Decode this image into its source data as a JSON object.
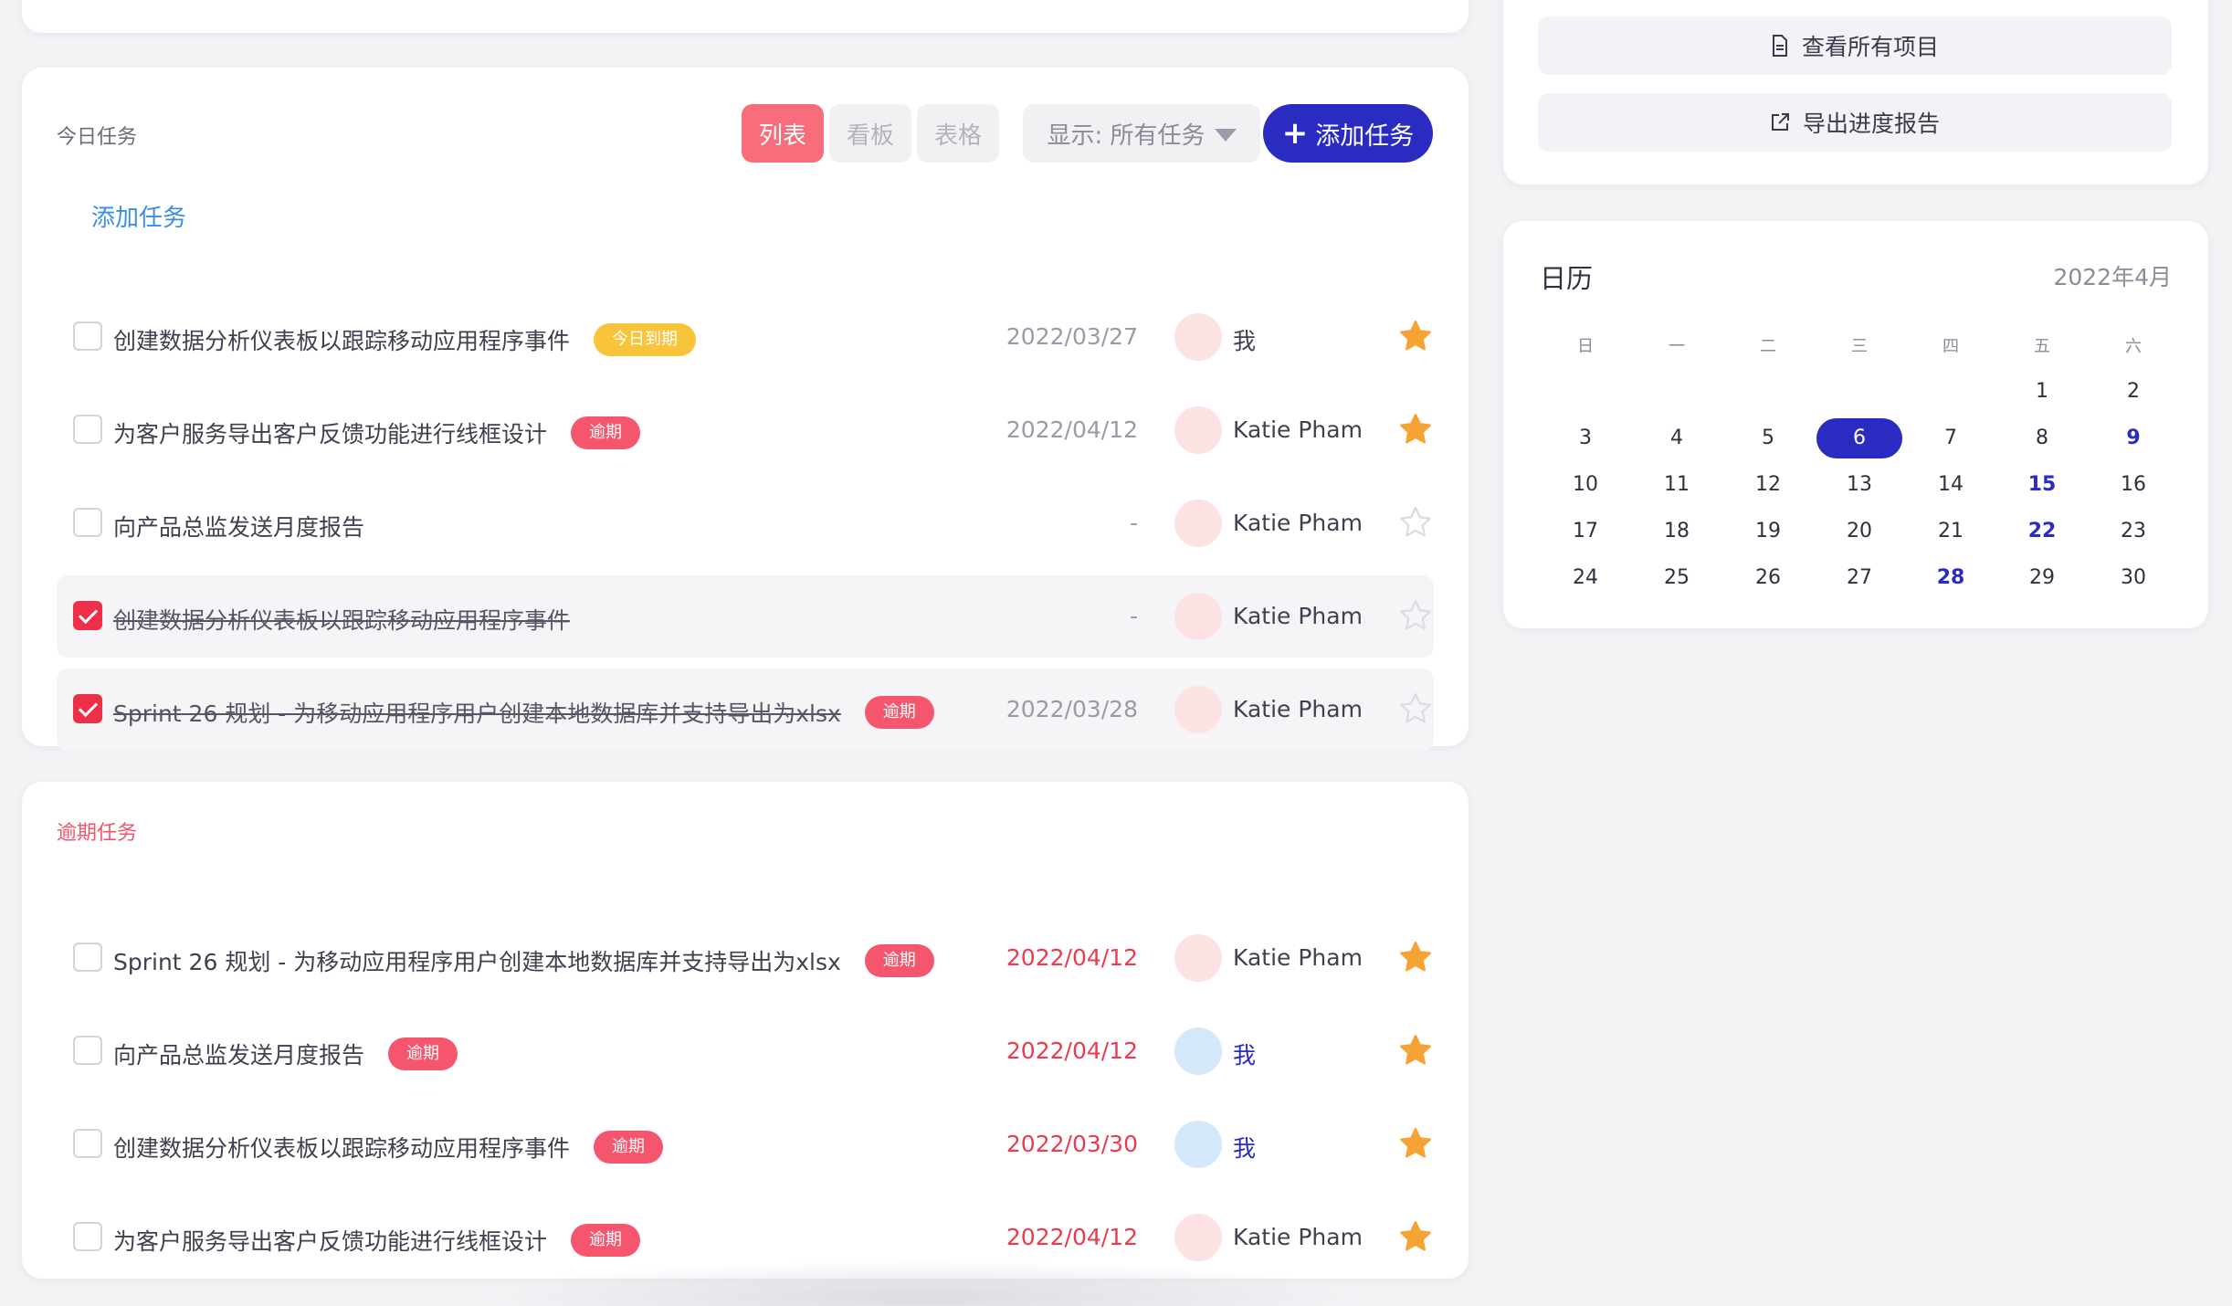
{
  "colors": {
    "accent": "#2a2bc0",
    "danger": "#f5556d",
    "warning": "#f8c53a",
    "star": "#f6a336"
  },
  "today": {
    "title": "今日任务",
    "views": [
      "列表",
      "看板",
      "表格"
    ],
    "filter_label": "显示: 所有任务",
    "add_button": "添加任务",
    "add_link": "添加任务",
    "tasks": [
      {
        "title": "创建数据分析仪表板以跟踪移动应用程序事件",
        "badge": "今日到期",
        "badge_color": "yellow",
        "due": "2022/03/27",
        "assignee": "我",
        "starred": true,
        "done": false
      },
      {
        "title": "为客户服务导出客户反馈功能进行线框设计",
        "badge": "逾期",
        "badge_color": "red",
        "due": "2022/04/12",
        "assignee": "Katie Pham",
        "starred": true,
        "done": false
      },
      {
        "title": "向产品总监发送月度报告",
        "badge": "",
        "due": "-",
        "assignee": "Katie Pham",
        "starred": false,
        "done": false
      },
      {
        "title": "创建数据分析仪表板以跟踪移动应用程序事件",
        "badge": "",
        "due": "-",
        "assignee": "Katie Pham",
        "starred": false,
        "done": true
      },
      {
        "title": "Sprint 26 规划 - 为移动应用程序用户创建本地数据库并支持导出为xlsx",
        "badge": "逾期",
        "badge_color": "red",
        "due": "2022/03/28",
        "assignee": "Katie Pham",
        "starred": false,
        "done": true
      }
    ]
  },
  "overdue": {
    "title": "逾期任务",
    "tasks": [
      {
        "title": "Sprint 26 规划 - 为移动应用程序用户创建本地数据库并支持导出为xlsx",
        "badge": "逾期",
        "due": "2022/04/12",
        "assignee": "Katie Pham",
        "starred": true
      },
      {
        "title": "向产品总监发送月度报告",
        "badge": "逾期",
        "due": "2022/04/12",
        "assignee": "我",
        "starred": true
      },
      {
        "title": "创建数据分析仪表板以跟踪移动应用程序事件",
        "badge": "逾期",
        "due": "2022/03/30",
        "assignee": "我",
        "starred": true
      },
      {
        "title": "为客户服务导出客户反馈功能进行线框设计",
        "badge": "逾期",
        "due": "2022/04/12",
        "assignee": "Katie Pham",
        "starred": true
      }
    ]
  },
  "actions": {
    "view_all": "查看所有项目",
    "export": "导出进度报告"
  },
  "calendar": {
    "title": "日历",
    "month": "2022年4月",
    "weekdays": [
      "日",
      "一",
      "二",
      "三",
      "四",
      "五",
      "六"
    ],
    "days": [
      "1",
      "2",
      "3",
      "4",
      "5",
      "6",
      "7",
      "8",
      "9",
      "10",
      "11",
      "12",
      "13",
      "14",
      "15",
      "16",
      "17",
      "18",
      "19",
      "20",
      "21",
      "22",
      "23",
      "24",
      "25",
      "26",
      "27",
      "28",
      "29",
      "30"
    ],
    "today": "6",
    "highlighted": [
      "9",
      "15",
      "22",
      "28"
    ]
  }
}
